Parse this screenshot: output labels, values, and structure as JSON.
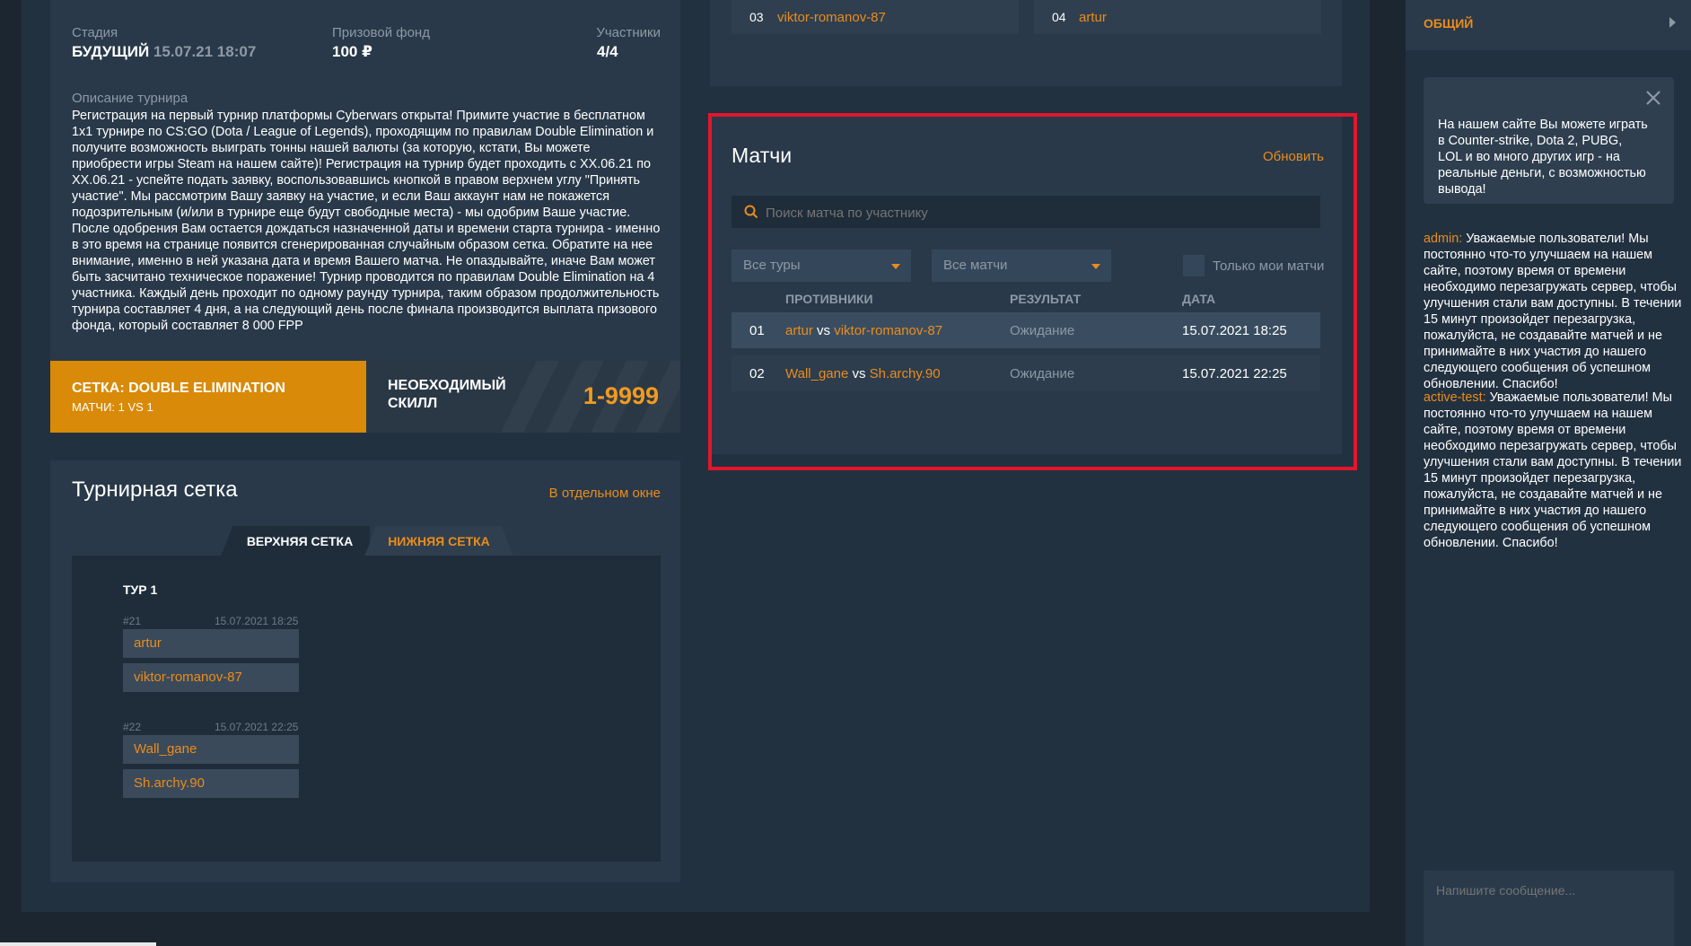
{
  "tournament": {
    "stage_label": "Стадия",
    "stage_value": "БУДУЩИЙ",
    "stage_date": "15.07.21 18:07",
    "prize_label": "Призовой фонд",
    "prize_value": "100 ₽",
    "participants_label": "Участники",
    "participants_value": "4/4",
    "description_label": "Описание турнира",
    "description_lines": [
      "Регистрация на первый турнир платформы Cyberwars открыта! Примите участие в бесплатном",
      "1x1 турнире по CS:GO (Dota / League of Legends), проходящим по правилам Double Elimination и",
      "получите возможность выиграть тонны нашей валюты (за которую, кстати, Вы можете",
      "приобрести игры Steam на нашем сайте)! Регистрация на турнир будет проходить с XX.06.21 по",
      "XX.06.21 - успейте подать заявку, воспользовавшись кнопкой в правом верхнем углу \"Принять",
      "участие\". Мы рассмотрим Вашу заявку на участие, и если Ваш аккаунт нам не покажется",
      "подозрительным (и/или в турнире еще будут свободные места) - мы одобрим Ваше участие.",
      "После одобрения Вам остается дождаться назначенной даты и времени старта турнира - именно",
      "в это время на странице появится сгенерированная случайным образом сетка. Обратите на нее",
      "внимание, именно в ней указана дата и время Вашего матча. Не опаздывайте, иначе Вам может",
      "быть засчитано техническое поражение! Турнир проводится по правилам Double Elimination на 4",
      "участника. Каждый день проходит по одному раунду турнира, таким образом продолжительность",
      "турнира составляет 4 дня, а на следующий день после финала производится выплата призового",
      "фонда, который составляет 8 000 FPP"
    ],
    "grid_type": "СЕТКА: DOUBLE ELIMINATION",
    "matches_format": "МАТЧИ: 1 VS 1",
    "skill_label_line1": "НЕОБХОДИМЫЙ",
    "skill_label_line2": "СКИЛЛ",
    "skill_value": "1-9999"
  },
  "bracket": {
    "title": "Турнирная сетка",
    "open_window_link": "В отдельном окне",
    "tabs": [
      {
        "label": "ВЕРХНЯЯ СЕТКА",
        "active": true
      },
      {
        "label": "НИЖНЯЯ СЕТКА",
        "active": false
      }
    ],
    "round_title": "ТУР 1",
    "matches": [
      {
        "id": "#21",
        "time": "15.07.2021 18:25",
        "player1": "artur",
        "player2": "viktor-romanov-87"
      },
      {
        "id": "#22",
        "time": "15.07.2021 22:25",
        "player1": "Wall_gane",
        "player2": "Sh.archy.90"
      }
    ]
  },
  "participants_top": [
    {
      "num": "03",
      "name": "viktor-romanov-87"
    },
    {
      "num": "04",
      "name": "artur"
    }
  ],
  "matches_panel": {
    "title": "Матчи",
    "refresh_label": "Обновить",
    "search_placeholder": "Поиск матча по участнику",
    "filter_rounds": "Все туры",
    "filter_matches": "Все матчи",
    "only_my_label": "Только мои матчи",
    "columns": [
      "ПРОТИВНИКИ",
      "РЕЗУЛЬТАТ",
      "ДАТА"
    ],
    "rows": [
      {
        "num": "01",
        "p1": "artur",
        "vs": "vs",
        "p2": "viktor-romanov-87",
        "result": "Ожидание",
        "date": "15.07.2021 18:25"
      },
      {
        "num": "02",
        "p1": "Wall_gane",
        "vs": "vs",
        "p2": "Sh.archy.90",
        "result": "Ожидание",
        "date": "15.07.2021 22:25"
      }
    ]
  },
  "chat": {
    "channel": "ОБЩИЙ",
    "notice": "На нашем сайте Вы можете играть в Counter-strike, Dota 2, PUBG, LOL и во много других игр - на реальные деньги, с возможностью вывода!",
    "messages": [
      {
        "author": "admin:",
        "text": "Уважаемые пользователи! Мы постоянно что-то улучшаем на нашем сайте, поэтому время от времени необходимо перезагружать сервер, чтобы улучшения стали вам доступны. В течении 15 минут произойдет перезагрузка, пожалуйста, не создавайте матчей и не принимайте в них участия до нашего следующего сообщения об успешном обновлении. Спасибо!"
      },
      {
        "author": "active-test:",
        "text": "Уважаемые пользователи! Мы постоянно что-то улучшаем на нашем сайте, поэтому время от времени необходимо перезагружать сервер, чтобы улучшения стали вам доступны. В течении 15 минут произойдет перезагрузка, пожалуйста, не создавайте матчей и не принимайте в них участия до нашего следующего сообщения об успешном обновлении. Спасибо!"
      }
    ],
    "input_placeholder": "Напишите сообщение..."
  },
  "colors": {
    "accent": "#ea8c1c",
    "highlight_border": "#e3162b",
    "panel": "#293949",
    "background": "#1c2631"
  }
}
